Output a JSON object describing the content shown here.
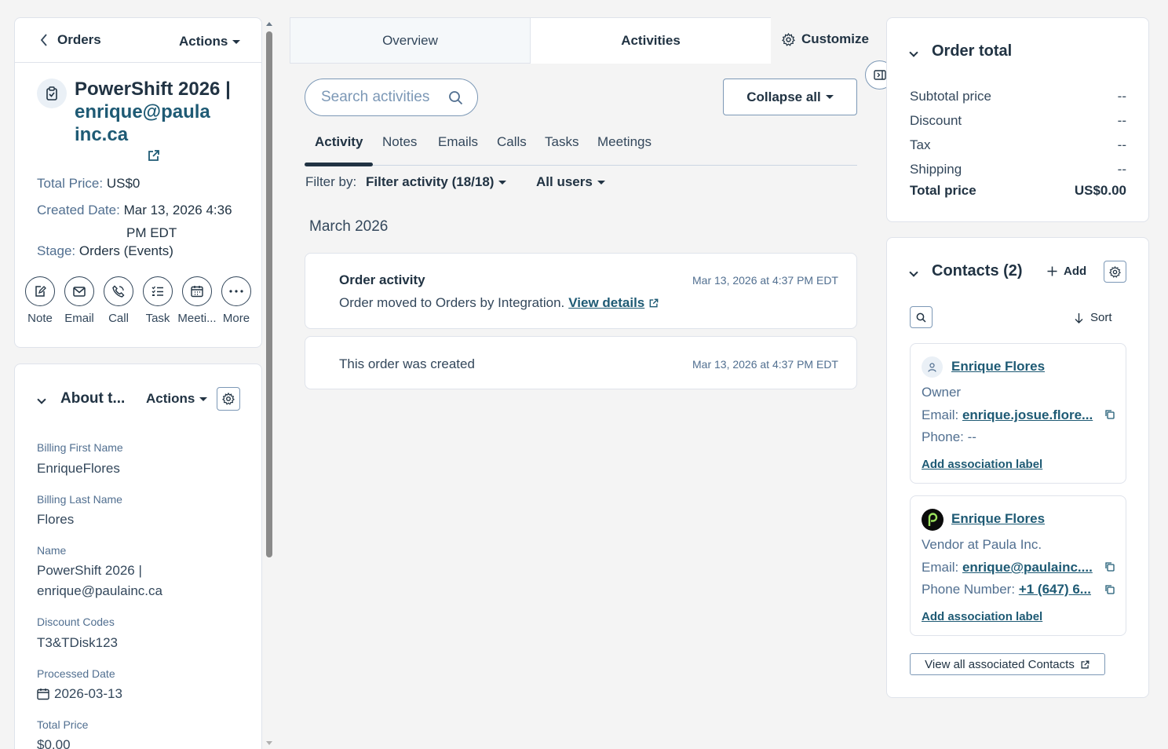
{
  "left": {
    "back_label": "Orders",
    "actions_label": "Actions",
    "record_title": "PowerShift 2026 |",
    "record_email": "enrique@paulainc.ca",
    "total_price_label": "Total Price:",
    "total_price_value": "US$0",
    "created_label": "Created Date:",
    "created_value_1": "Mar 13, 2026 4:36",
    "created_value_2": "PM EDT",
    "stage_label": "Stage:",
    "stage_value": "Orders (Events)",
    "action_buttons": [
      "Note",
      "Email",
      "Call",
      "Task",
      "Meeti...",
      "More"
    ],
    "about": {
      "title": "About t...",
      "actions_label": "Actions",
      "billing_first_label": "Billing First Name",
      "billing_first_value": "EnriqueFlores",
      "billing_last_label": "Billing Last Name",
      "billing_last_value": "Flores",
      "name_label": "Name",
      "name_value_1": "PowerShift 2026 |",
      "name_value_2": "enrique@paulainc.ca",
      "discount_label": "Discount Codes",
      "discount_value": "T3&TDisk123",
      "processed_label": "Processed Date",
      "processed_value": "2026-03-13",
      "total_label": "Total Price",
      "total_value": "$0.00"
    }
  },
  "center": {
    "tabs": [
      "Overview",
      "Activities"
    ],
    "customize_label": "Customize",
    "search_placeholder": "Search activities",
    "collapse_label": "Collapse all",
    "subtabs": [
      "Activity",
      "Notes",
      "Emails",
      "Calls",
      "Tasks",
      "Meetings"
    ],
    "filter_by_label": "Filter by:",
    "filter_activity": "Filter activity (18/18)",
    "all_users": "All users",
    "month_header": "March 2026",
    "activities": [
      {
        "title": "Order activity",
        "text": "Order moved to Orders by Integration.",
        "link": "View details",
        "time": "Mar 13, 2026 at 4:37 PM EDT"
      },
      {
        "text": "This order was created",
        "time": "Mar 13, 2026 at 4:37 PM EDT"
      }
    ]
  },
  "right": {
    "order_total": {
      "title": "Order total",
      "rows": [
        {
          "label": "Subtotal price",
          "value": "--"
        },
        {
          "label": "Discount",
          "value": "--"
        },
        {
          "label": "Tax",
          "value": "--"
        },
        {
          "label": "Shipping",
          "value": "--"
        }
      ],
      "total_label": "Total price",
      "total_value": "US$0.00"
    },
    "contacts": {
      "title": "Contacts (2)",
      "add_label": "Add",
      "sort_label": "Sort",
      "items": [
        {
          "name": "Enrique Flores",
          "role": "Owner",
          "email_label": "Email:",
          "email": "enrique.josue.flore...",
          "phone_label": "Phone:",
          "phone": "--",
          "assoc_label": "Add association label"
        },
        {
          "name": "Enrique Flores",
          "role": "Vendor at Paula Inc.",
          "email_label": "Email:",
          "email": "enrique@paulainc....",
          "phone_label": "Phone Number:",
          "phone": "+1 (647) 6...",
          "assoc_label": "Add association label"
        }
      ],
      "view_all_label": "View all associated Contacts"
    }
  },
  "colors": {
    "link": "#1e5a74",
    "text": "#213343",
    "border": "#dfe3eb",
    "background": "#f4f4f4"
  }
}
